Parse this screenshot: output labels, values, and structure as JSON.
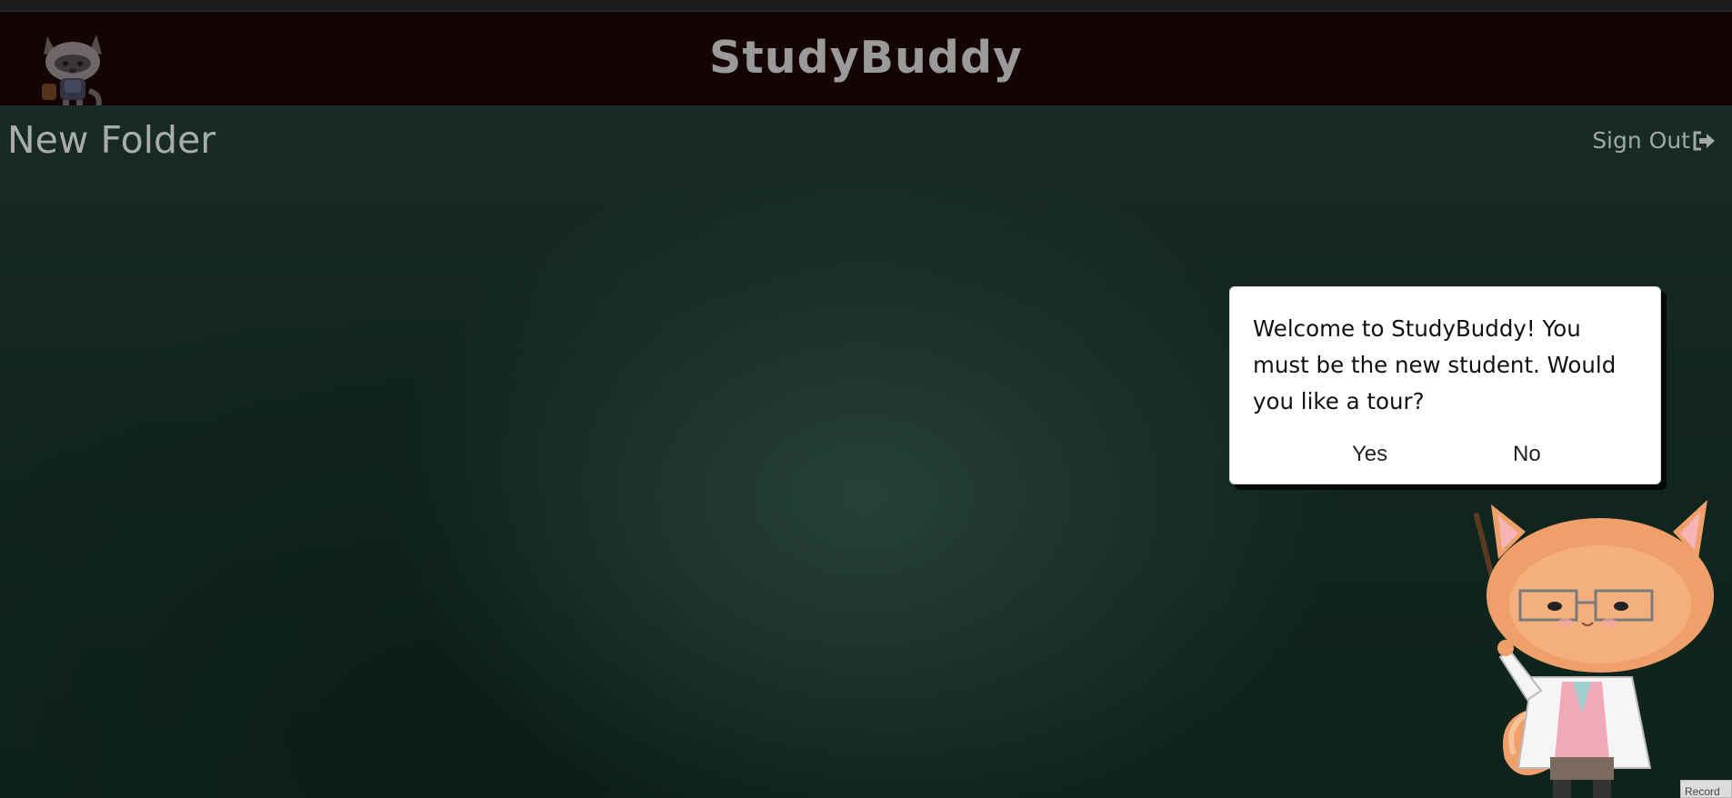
{
  "header": {
    "title": "StudyBuddy",
    "logo_icon": "raccoon-mascot-logo"
  },
  "folder": {
    "title": "New Folder"
  },
  "account": {
    "sign_out_label": "Sign Out",
    "sign_out_icon": "sign-out-icon"
  },
  "tour_dialog": {
    "message": "Welcome to StudyBuddy! You must be the new student. Would you like a tour?",
    "yes_label": "Yes",
    "no_label": "No"
  },
  "mascot": {
    "icon": "cat-teacher-mascot"
  },
  "record_tag": {
    "label": "Record"
  },
  "colors": {
    "header_bg": "#150404",
    "board_bg": "#0d211c",
    "dialog_bg": "#ffffff",
    "text_muted": "#9a9a9a"
  }
}
